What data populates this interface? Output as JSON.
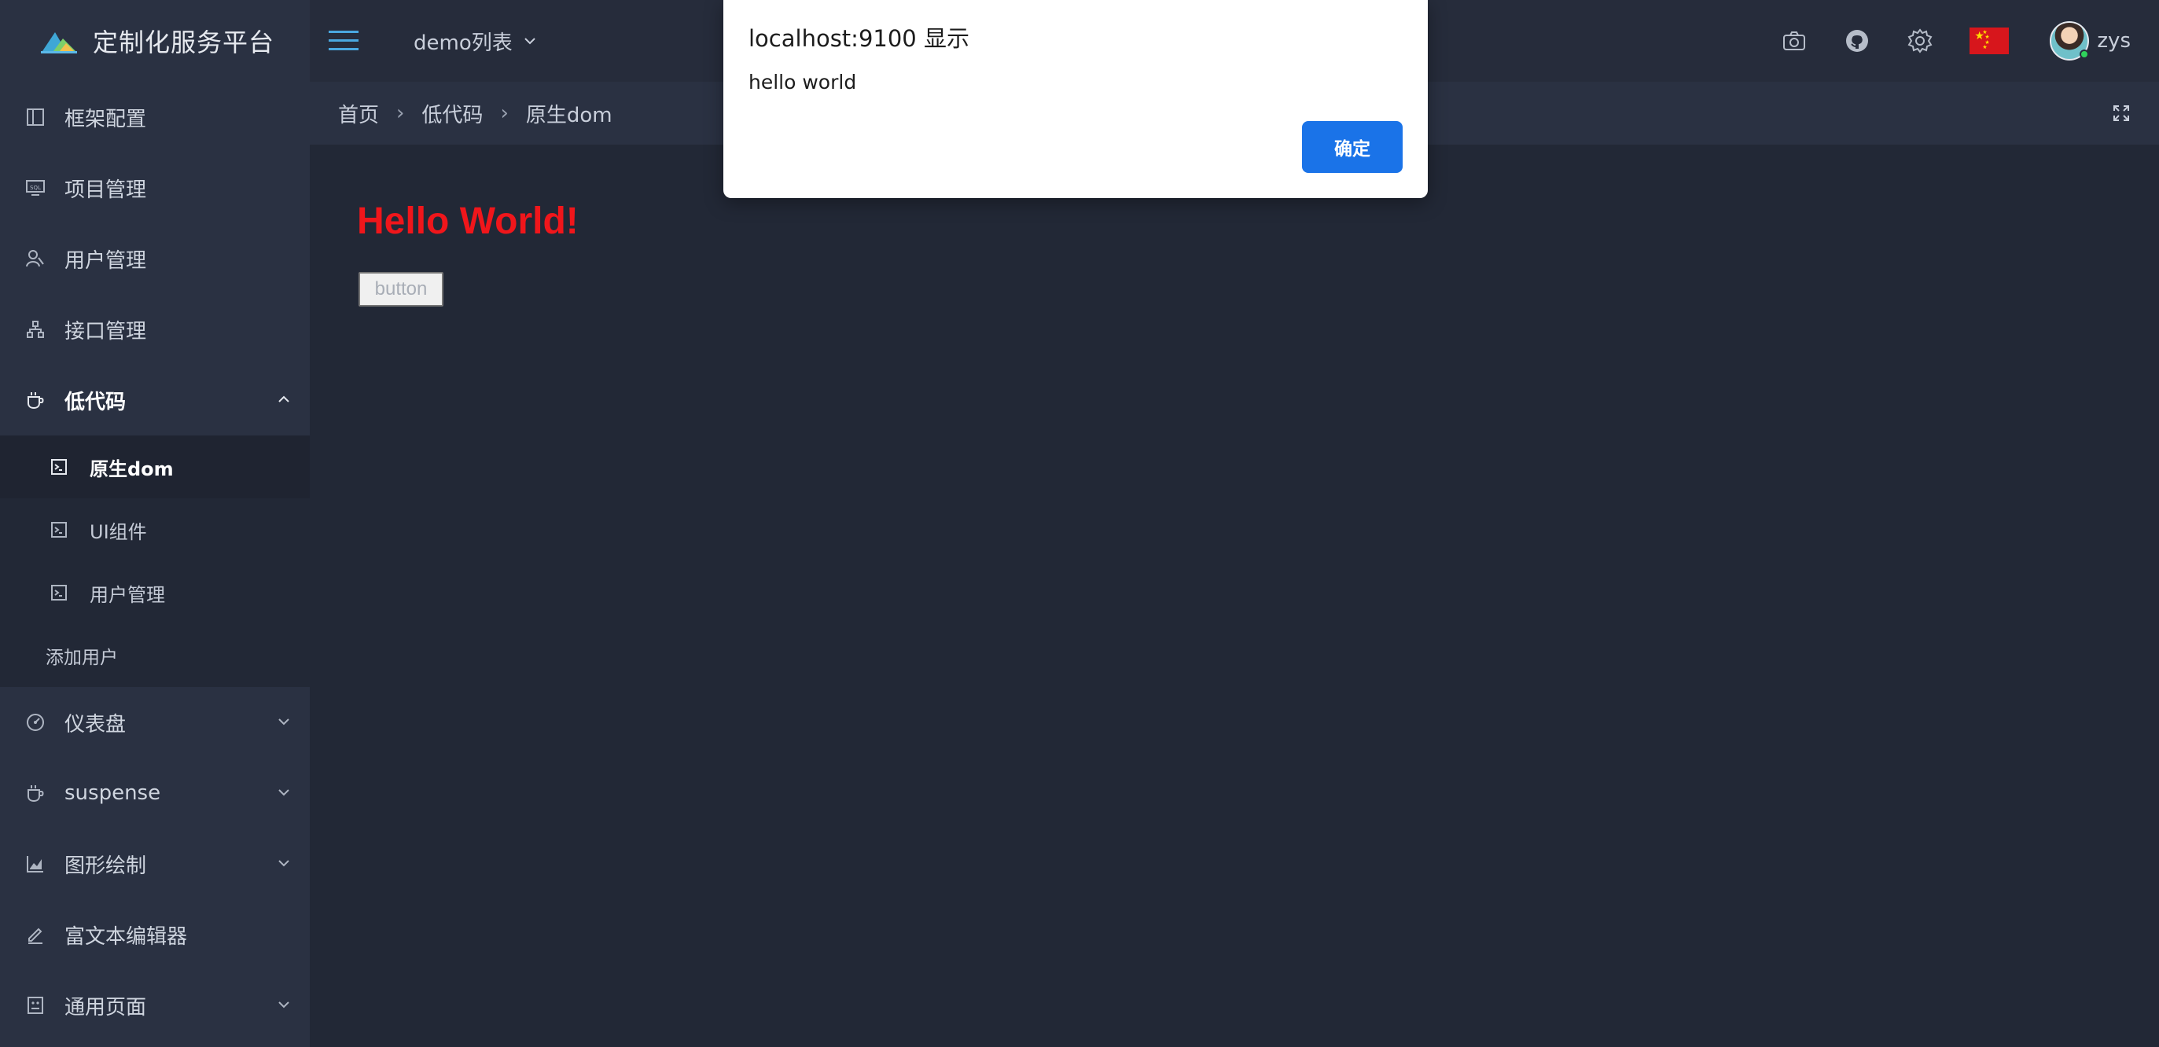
{
  "app": {
    "title": "定制化服务平台"
  },
  "header": {
    "demo_menu": "demo列表",
    "username": "zys"
  },
  "sidebar": {
    "items": [
      {
        "label": "框架配置",
        "icon": "layout-icon"
      },
      {
        "label": "项目管理",
        "icon": "monitor-icon"
      },
      {
        "label": "用户管理",
        "icon": "users-icon"
      },
      {
        "label": "接口管理",
        "icon": "network-icon"
      },
      {
        "label": "低代码",
        "icon": "cup-icon",
        "expanded": true
      }
    ],
    "submenu": [
      {
        "label": "原生dom",
        "active": true
      },
      {
        "label": "UI组件"
      },
      {
        "label": "用户管理"
      }
    ],
    "sub_plain": "添加用户",
    "items_after": [
      {
        "label": "仪表盘",
        "icon": "dashboard-icon"
      },
      {
        "label": "suspense",
        "icon": "cup-icon"
      },
      {
        "label": "图形绘制",
        "icon": "chart-icon"
      },
      {
        "label": "富文本编辑器",
        "icon": "edit-icon"
      },
      {
        "label": "通用页面",
        "icon": "page-icon"
      }
    ]
  },
  "breadcrumb": [
    "首页",
    "低代码",
    "原生dom"
  ],
  "breadcrumb_sep": "›",
  "content": {
    "heading": "Hello World!",
    "button_label": "button"
  },
  "dialog": {
    "title": "localhost:9100 显示",
    "message": "hello world",
    "ok_label": "确定"
  },
  "colors": {
    "accent": "#1a73e8",
    "heading": "#f0161b",
    "sidebar_bg": "#2a3142",
    "main_bg": "#222836"
  }
}
